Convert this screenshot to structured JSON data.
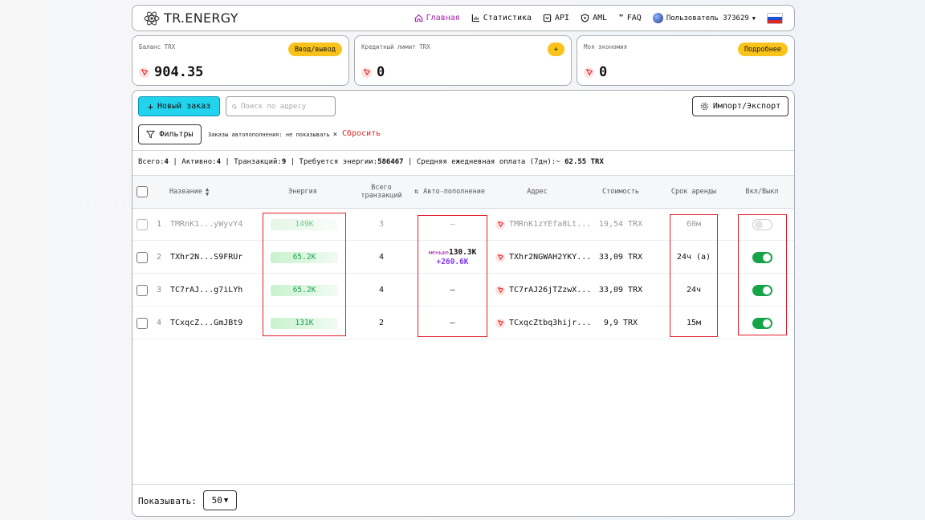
{
  "brand": {
    "logo_text": "TR.ENERGY"
  },
  "nav": [
    {
      "label": "Главная",
      "icon": "home-icon",
      "active": true
    },
    {
      "label": "Статистика",
      "icon": "chart-icon"
    },
    {
      "label": "API",
      "icon": "api-icon"
    },
    {
      "label": "AML",
      "icon": "shield-icon"
    },
    {
      "label": "FAQ",
      "icon": "quote-icon"
    }
  ],
  "user": {
    "name": "Пользователь 373629"
  },
  "cards": [
    {
      "label": "Баланс TRX",
      "button": "Ввод/вывод",
      "value": "904.35"
    },
    {
      "label": "Кредитный лимит TRX",
      "button": "+",
      "value": "0"
    },
    {
      "label": "Моя экономия",
      "button": "Подробнее",
      "value": "0"
    }
  ],
  "toolbar": {
    "new_order": "Новый заказ",
    "search_placeholder": "Поиск по адресу",
    "import_export": "Импорт/Экспорт",
    "filters": "Фильтры",
    "filter_tag": "Заказы автопополнения: не показывать",
    "reset": "Сбросить"
  },
  "stats": {
    "total_label": "Всего:",
    "total": "4",
    "active_label": "Активно:",
    "active": "4",
    "tx_label": "Транзакций:",
    "tx": "9",
    "energy_label": "Требуется энергии:",
    "energy": "586467",
    "avg_label": "Средняя ежедневная оплата (7дн):~",
    "avg": "62.55 TRX"
  },
  "table": {
    "headers": {
      "name": "Название",
      "energy": "Энергия",
      "tx": "Всего транзакций",
      "auto": "Авто-пополнение",
      "address": "Адрес",
      "cost": "Стоимость",
      "term": "Срок аренды",
      "toggle": "Вкл/Выкл"
    },
    "rows": [
      {
        "n": "1",
        "name": "TMRnK1...yWyvY4",
        "energy": "149K",
        "tx": "3",
        "auto": "—",
        "address": "TMRnK1zYEfa8Lt...",
        "cost": "19,54 TRX",
        "term": "60м",
        "enabled": false
      },
      {
        "n": "2",
        "name": "TXhr2N...S9FRUr",
        "energy": "65.2K",
        "tx": "4",
        "auto_prefix": "меньше",
        "auto": "130.3K",
        "auto_add": "+260.6K",
        "address": "TXhr2NGWAH2YKY...",
        "cost": "33,09 TRX",
        "term": "24ч (а)",
        "enabled": true
      },
      {
        "n": "3",
        "name": "TC7rAJ...g7iLYh",
        "energy": "65.2K",
        "tx": "4",
        "auto": "—",
        "address": "TC7rAJ26jTZzwX...",
        "cost": "33,09 TRX",
        "term": "24ч",
        "enabled": true
      },
      {
        "n": "4",
        "name": "TCxqcZ...GmJBt9",
        "energy": "131K",
        "tx": "2",
        "auto": "—",
        "address": "TCxqcZtbq3hijr...",
        "cost": "9,9 TRX",
        "term": "15м",
        "enabled": true
      }
    ]
  },
  "footer": {
    "show_label": "Показывать:",
    "page_size": "50"
  },
  "colors": {
    "accent": "#22d3ee",
    "active_nav": "#a21caf",
    "highlight": "#e11d2a",
    "toggle_on": "#16a34a",
    "badge": "#f9c31b"
  }
}
